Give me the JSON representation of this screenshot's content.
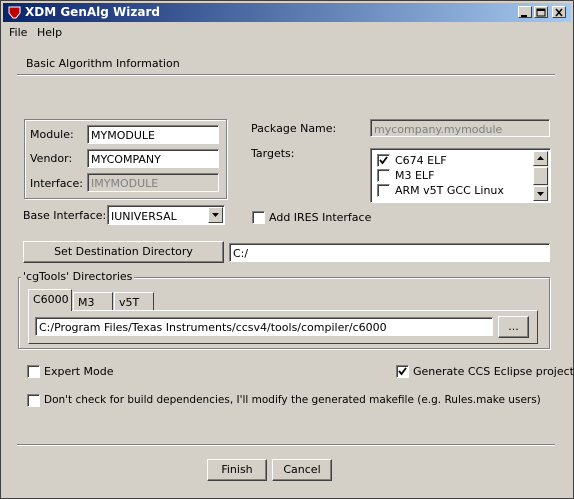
{
  "window": {
    "title": "XDM GenAlg Wizard"
  },
  "menu": {
    "file": "File",
    "help": "Help"
  },
  "section_title": "Basic Algorithm Information",
  "fields": {
    "module_label": "Module:",
    "module_value": "MYMODULE",
    "vendor_label": "Vendor:",
    "vendor_value": "MYCOMPANY",
    "interface_label": "Interface:",
    "interface_value": "IMYMODULE",
    "package_label": "Package Name:",
    "package_value": "mycompany.mymodule",
    "targets_label": "Targets:",
    "base_interface_label": "Base Interface:",
    "base_interface_value": "IUNIVERSAL"
  },
  "targets": [
    {
      "label": "C674 ELF",
      "checked": true
    },
    {
      "label": "M3 ELF",
      "checked": false
    },
    {
      "label": "ARM v5T GCC Linux",
      "checked": false
    }
  ],
  "ires": {
    "label": "Add IRES Interface",
    "checked": false
  },
  "destination": {
    "button": "Set Destination Directory",
    "value": "C:/"
  },
  "cgtools": {
    "group_label": "'cgTools' Directories",
    "tabs": [
      "C6000",
      "M3",
      "v5T"
    ],
    "path": "C:/Program Files/Texas Instruments/ccsv4/tools/compiler/c6000",
    "browse": "..."
  },
  "options": {
    "expert_mode": {
      "label": "Expert Mode",
      "checked": false
    },
    "generate_ccs": {
      "label": "Generate CCS Eclipse project",
      "checked": true
    },
    "no_deps": {
      "label": "Don't check for build dependencies, I'll modify the generated makefile (e.g. Rules.make users)",
      "checked": false
    }
  },
  "buttons": {
    "finish": "Finish",
    "cancel": "Cancel"
  }
}
